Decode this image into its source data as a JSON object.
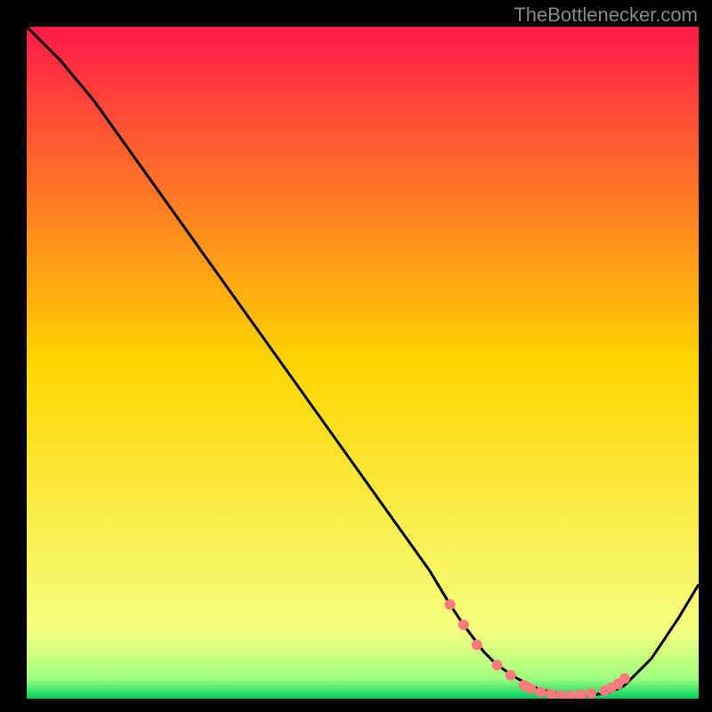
{
  "watermark": "TheBottlenecker.com",
  "chart_data": {
    "type": "line",
    "title": "",
    "xlabel": "",
    "ylabel": "",
    "xlim": [
      0,
      100
    ],
    "ylim": [
      0,
      100
    ],
    "background_gradient": {
      "stops": [
        {
          "offset": 0,
          "color": "#ff1a4a"
        },
        {
          "offset": 50,
          "color": "#ffd500"
        },
        {
          "offset": 90,
          "color": "#f5ff80"
        },
        {
          "offset": 97,
          "color": "#a0ff80"
        },
        {
          "offset": 100,
          "color": "#00d060"
        }
      ]
    },
    "series": [
      {
        "name": "curve",
        "x": [
          0,
          5,
          10,
          15,
          20,
          25,
          30,
          35,
          40,
          45,
          50,
          55,
          60,
          63,
          65,
          68,
          70,
          73,
          76,
          80,
          84,
          87,
          89,
          91,
          93,
          95,
          97,
          100
        ],
        "values": [
          100,
          95,
          89,
          82,
          75,
          68,
          61,
          54,
          47,
          40,
          33,
          26,
          19,
          14,
          11,
          7,
          5,
          3,
          1.5,
          0.5,
          0.5,
          1,
          2,
          4,
          6,
          9,
          12,
          17
        ]
      }
    ],
    "markers": {
      "name": "dots",
      "x": [
        63,
        65,
        67,
        70,
        72,
        74,
        75,
        76.5,
        78,
        79.5,
        81,
        82.5,
        84,
        86,
        87,
        88,
        89
      ],
      "values": [
        14,
        11,
        8,
        5,
        3.5,
        2,
        1.5,
        1,
        0.7,
        0.5,
        0.5,
        0.6,
        0.8,
        1.2,
        1.6,
        2.2,
        3
      ],
      "color": "#ff7b7b",
      "radius": 6
    }
  }
}
